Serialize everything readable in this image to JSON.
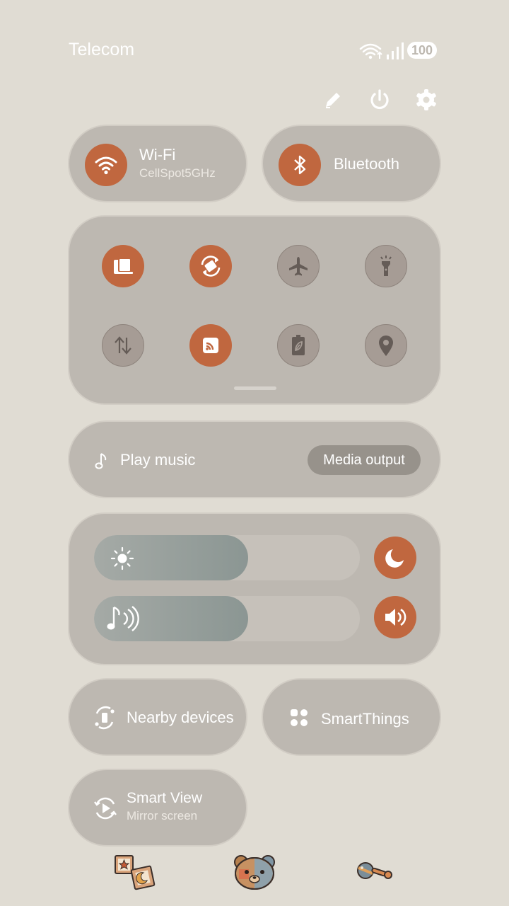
{
  "status_bar": {
    "carrier": "Telecom",
    "battery": "100",
    "icons": [
      "wifi-icon",
      "signal-icon",
      "battery-icon"
    ]
  },
  "actions": {
    "edit": "edit-icon",
    "power": "power-icon",
    "settings": "gear-icon"
  },
  "wifi": {
    "label": "Wi-Fi",
    "network": "CellSpot5GHz",
    "active": true
  },
  "bluetooth": {
    "label": "Bluetooth",
    "active": true
  },
  "quick_toggles": [
    {
      "icon": "display-icon",
      "active": true
    },
    {
      "icon": "auto-rotate-icon",
      "active": true
    },
    {
      "icon": "airplane-icon",
      "active": false
    },
    {
      "icon": "flashlight-icon",
      "active": false
    },
    {
      "icon": "mobile-data-icon",
      "active": false
    },
    {
      "icon": "cast-icon",
      "active": true
    },
    {
      "icon": "power-saving-icon",
      "active": false
    },
    {
      "icon": "location-icon",
      "active": false
    }
  ],
  "media": {
    "label": "Play music",
    "output_button": "Media output"
  },
  "brightness": {
    "level": 0.58,
    "night_mode_icon": "moon-icon"
  },
  "volume": {
    "level": 0.58,
    "sound_mode_icon": "speaker-icon"
  },
  "nearby": {
    "label": "Nearby devices"
  },
  "smartthings": {
    "label": "SmartThings"
  },
  "smart_view": {
    "label": "Smart View",
    "sub": "Mirror screen"
  },
  "stickers": [
    "stickers-icon",
    "teddy-bear-icon",
    "rattle-icon"
  ],
  "colors": {
    "accent": "#c0673f",
    "tile": "#bdb8b1",
    "background": "#e0dcd3"
  }
}
